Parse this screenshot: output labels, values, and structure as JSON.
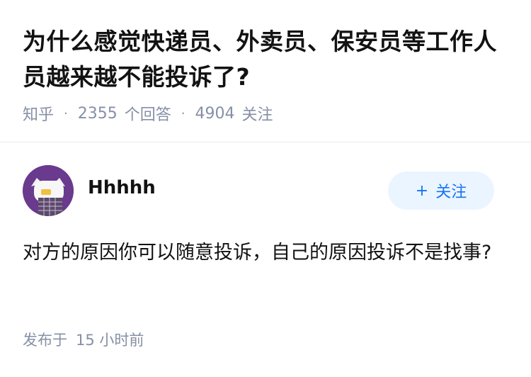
{
  "question": {
    "title": "为什么感觉快递员、外卖员、保安员等工作人员越来越不能投诉了?"
  },
  "meta": {
    "source": "知乎",
    "answers_count": "2355",
    "answers_label": "个回答",
    "followers_count": "4904",
    "followers_label": "关注",
    "separator": "·"
  },
  "answer": {
    "author_name": "Hhhhh",
    "follow_button": {
      "plus": "+",
      "label": "关注"
    },
    "content": "对方的原因你可以随意投诉，自己的原因投诉不是找事?",
    "publish_label": "发布于",
    "publish_time": "15 小时前"
  },
  "colors": {
    "title": "#121212",
    "meta": "#8590a6",
    "follow_bg": "#ebf5ff",
    "follow_text": "#1772f6",
    "avatar_bg": "#6a3a8e"
  }
}
